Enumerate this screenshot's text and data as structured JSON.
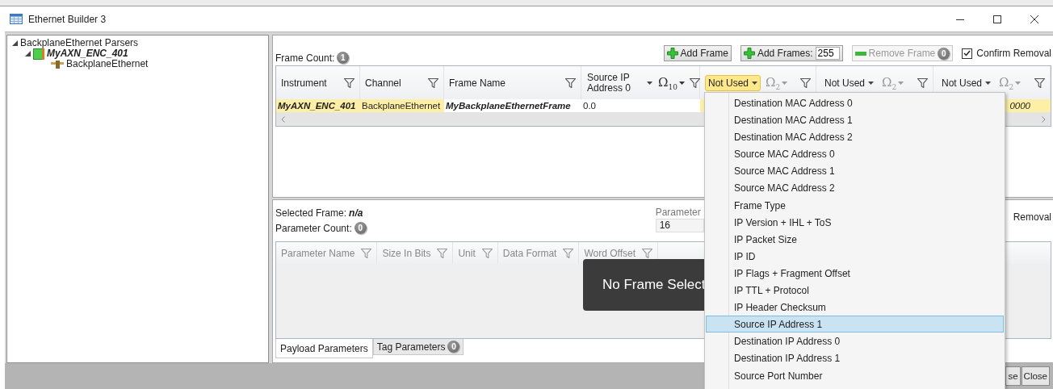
{
  "window": {
    "title": "Ethernet Builder 3"
  },
  "tree": [
    {
      "label": "BackplaneEthernet Parsers",
      "expanded": true,
      "children": [
        {
          "label": "MyAXN_ENC_401",
          "kind": "instrument",
          "expanded": true,
          "children": [
            {
              "label": "BackplaneEthernet",
              "kind": "channel"
            }
          ]
        }
      ]
    }
  ],
  "frames": {
    "count_label": "Frame Count:",
    "count": "1",
    "toolbar": {
      "add_frame": "Add Frame",
      "add_frames": {
        "label": "Add Frames:",
        "value": "255"
      },
      "remove_frame": {
        "label": "Remove Frame",
        "count": "0",
        "disabled": true
      },
      "confirm_removal": {
        "label": "Confirm Removal",
        "checked": true
      }
    },
    "columns": [
      {
        "kind": "text",
        "label": "Instrument"
      },
      {
        "kind": "text",
        "label": "Channel"
      },
      {
        "kind": "text",
        "label": "Frame Name"
      },
      {
        "kind": "mapping",
        "label": "Source IP Address 0",
        "unit": "Ω$_{10}$",
        "used": true,
        "open": false
      },
      {
        "kind": "mapping",
        "label": "Not Used",
        "unit": "Ω$_{2}$",
        "used": false,
        "open": true
      },
      {
        "kind": "mapping",
        "label": "Not Used",
        "unit": "Ω$_{2}$",
        "used": false,
        "open": false
      },
      {
        "kind": "mapping",
        "label": "Not Used",
        "unit": "Ω$_{2}$",
        "used": false,
        "open": false
      }
    ],
    "rows": [
      {
        "cells": [
          {
            "text": "MyAXN_ENC_401",
            "highlighted": true,
            "bold": true,
            "italic": true
          },
          {
            "text": "BackplaneEthernet",
            "highlighted": true,
            "bold": false,
            "italic": false
          },
          {
            "text": "MyBackplaneEthernetFrame",
            "highlighted": false,
            "bold": true,
            "italic": true
          },
          {
            "text": "0.0",
            "highlighted": false,
            "bold": false,
            "italic": false
          },
          {
            "highlighted": true
          },
          null,
          {
            "text": "0000",
            "highlighted": true,
            "bold": false,
            "italic": true
          }
        ]
      }
    ]
  },
  "parameters": {
    "selected_frame_label": "Selected Frame:",
    "selected_frame": "n/a",
    "count_label": "Parameter Count:",
    "count": "0",
    "field_label": "Parameter",
    "field_value": "16",
    "removal_label": "Removal",
    "columns": [
      "Parameter Name",
      "Size In Bits",
      "Unit",
      "Data Format",
      "Word Offset"
    ],
    "overlay": "No Frame Select",
    "tabs": [
      {
        "label": "Payload Parameters",
        "selected": true
      },
      {
        "label": "Tag Parameters",
        "count": "0",
        "selected": false
      }
    ]
  },
  "dropdown": {
    "items": [
      {
        "label": "Destination MAC Address 0",
        "selected": false
      },
      {
        "label": "Destination MAC Address 1",
        "selected": false
      },
      {
        "label": "Destination MAC Address 2",
        "selected": false
      },
      {
        "label": "Source MAC Address 0",
        "selected": false
      },
      {
        "label": "Source MAC Address 1",
        "selected": false
      },
      {
        "label": "Source MAC Address 2",
        "selected": false
      },
      {
        "label": "Frame Type",
        "selected": false
      },
      {
        "label": "IP Version + IHL + ToS",
        "selected": false
      },
      {
        "label": "IP Packet Size",
        "selected": false
      },
      {
        "label": "IP ID",
        "selected": false
      },
      {
        "label": "IP Flags + Fragment Offset",
        "selected": false
      },
      {
        "label": "IP TTL + Protocol",
        "selected": false
      },
      {
        "label": "IP Header Checksum",
        "selected": false
      },
      {
        "label": "Source IP Address 1",
        "selected": true
      },
      {
        "label": "Destination IP Address 0",
        "selected": false
      },
      {
        "label": "Destination IP Address 1",
        "selected": false
      },
      {
        "label": "Source Port Number",
        "selected": false
      }
    ]
  },
  "footer": {
    "buttons": [
      "se",
      "Close"
    ]
  }
}
